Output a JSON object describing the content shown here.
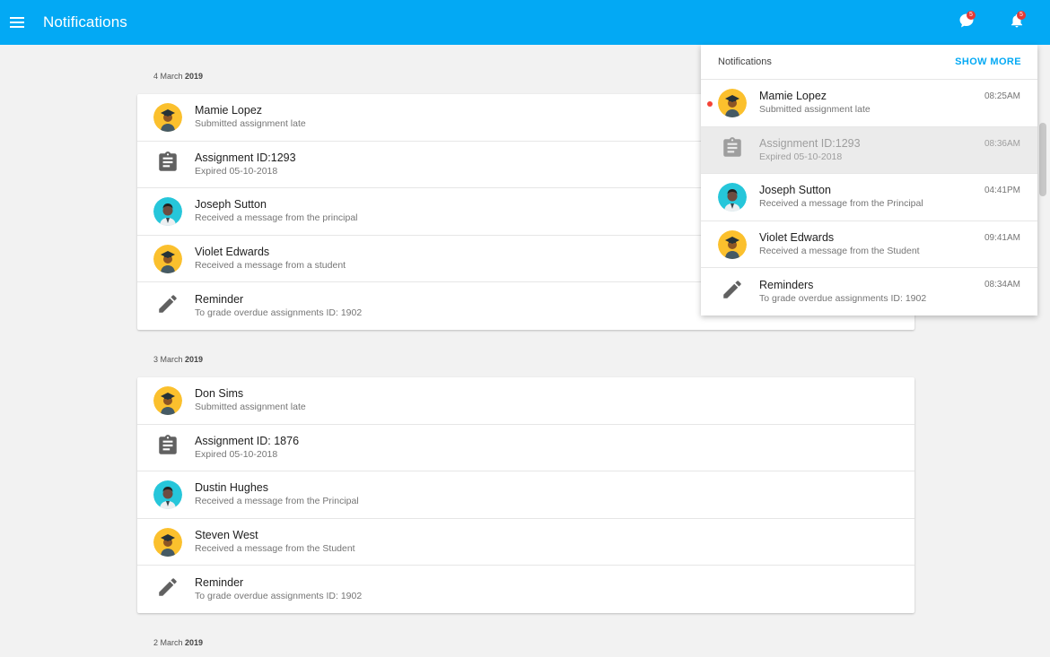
{
  "app": {
    "title": "Notifications"
  },
  "topbar": {
    "messages_badge": "5",
    "alerts_badge": "5"
  },
  "groups": [
    {
      "date_day": "4 March",
      "date_year": "2019",
      "items": [
        {
          "title": "Mamie Lopez",
          "subtitle": "Submitted assignment late",
          "icon": "graduate-avatar"
        },
        {
          "title": "Assignment ID:1293",
          "subtitle": "Expired 05-10-2018",
          "icon": "clipboard-icon"
        },
        {
          "title": "Joseph Sutton",
          "subtitle": "Received a message from the principal",
          "icon": "teacher-avatar"
        },
        {
          "title": "Violet Edwards",
          "subtitle": "Received a message from a student",
          "icon": "graduate-avatar"
        },
        {
          "title": "Reminder",
          "subtitle": "To grade overdue assignments ID: 1902",
          "icon": "pencil-icon"
        }
      ]
    },
    {
      "date_day": "3 March",
      "date_year": "2019",
      "items": [
        {
          "title": "Don Sims",
          "subtitle": "Submitted assignment late",
          "icon": "graduate-avatar"
        },
        {
          "title": "Assignment ID: 1876",
          "subtitle": "Expired 05-10-2018",
          "icon": "clipboard-icon"
        },
        {
          "title": "Dustin Hughes",
          "subtitle": "Received a message from the Principal",
          "icon": "teacher-avatar"
        },
        {
          "title": "Steven West",
          "subtitle": "Received a message from the Student",
          "icon": "graduate-avatar"
        },
        {
          "title": "Reminder",
          "subtitle": "To grade overdue assignments ID: 1902",
          "icon": "pencil-icon"
        }
      ]
    },
    {
      "date_day": "2 March",
      "date_year": "2019",
      "items": []
    }
  ],
  "panel": {
    "title": "Notifications",
    "show_more": "SHOW MORE",
    "items": [
      {
        "title": "Mamie Lopez",
        "subtitle": "Submitted assignment late",
        "time": "08:25AM",
        "icon": "graduate-avatar",
        "unread": true
      },
      {
        "title": "Assignment ID:1293",
        "subtitle": "Expired 05-10-2018",
        "time": "08:36AM",
        "icon": "clipboard-icon",
        "selected": true
      },
      {
        "title": "Joseph Sutton",
        "subtitle": "Received a message from the Principal",
        "time": "04:41PM",
        "icon": "teacher-avatar"
      },
      {
        "title": "Violet Edwards",
        "subtitle": "Received a message from the Student",
        "time": "09:41AM",
        "icon": "graduate-avatar"
      },
      {
        "title": "Reminders",
        "subtitle": "To grade overdue assignments ID: 1902",
        "time": "08:34AM",
        "icon": "pencil-icon"
      }
    ]
  },
  "colors": {
    "accent": "#03a9f4",
    "badge": "#e53935",
    "avatar_orange": "#fbc02d",
    "avatar_teal": "#26c6da"
  }
}
